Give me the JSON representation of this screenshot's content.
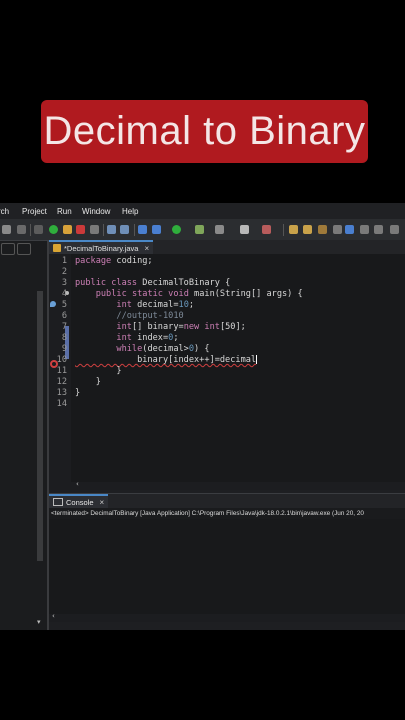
{
  "banner": {
    "title": "Decimal to Binary"
  },
  "menu": [
    "rch",
    "Project",
    "Run",
    "Window",
    "Help"
  ],
  "editor_tab": {
    "label": "*DecimalToBinary.java",
    "close": "×"
  },
  "code_lines": [
    {
      "n": "1",
      "tokens": [
        {
          "t": "package coding;",
          "c": "kw-mixed"
        }
      ]
    },
    {
      "n": "2",
      "tokens": []
    },
    {
      "n": "3",
      "tokens": []
    },
    {
      "n": "4",
      "tokens": []
    },
    {
      "n": "5",
      "tokens": []
    },
    {
      "n": "6",
      "tokens": []
    },
    {
      "n": "7",
      "tokens": []
    },
    {
      "n": "8",
      "tokens": []
    },
    {
      "n": "9",
      "tokens": []
    },
    {
      "n": "10",
      "tokens": []
    },
    {
      "n": "11",
      "tokens": []
    },
    {
      "n": "12",
      "tokens": []
    },
    {
      "n": "13",
      "tokens": []
    },
    {
      "n": "14",
      "tokens": []
    }
  ],
  "code": {
    "l1a": "package",
    "l1b": " coding;",
    "l3a": "public",
    "l3b": " ",
    "l3c": "class",
    "l3d": " DecimalToBinary {",
    "l4a": "    ",
    "l4b": "public",
    "l4c": " ",
    "l4d": "static",
    "l4e": " ",
    "l4f": "void",
    "l4g": " main(String[] args) {",
    "l5a": "        ",
    "l5b": "int",
    "l5c": " decimal=",
    "l5d": "10",
    "l5e": ";",
    "l6a": "        ",
    "l6b": "//output-1010",
    "l7a": "        ",
    "l7b": "int",
    "l7c": "[] binary=",
    "l7d": "new",
    "l7e": " ",
    "l7f": "int",
    "l7g": "[50];",
    "l8a": "        ",
    "l8b": "int",
    "l8c": " index=",
    "l8d": "0",
    "l8e": ";",
    "l9a": "        ",
    "l9b": "while",
    "l9c": "(decimal>",
    "l9d": "0",
    "l9e": ") {",
    "l10a": "            binary[index++]=decimal",
    "l11a": "        }",
    "l12a": "    }",
    "l13a": "}",
    "l14a": ""
  },
  "console_tab": {
    "label": "Console",
    "close": "×"
  },
  "console_status": "<terminated> DecimalToBinary [Java Application] C:\\Program Files\\Java\\jdk-18.0.2.1\\bin\\javaw.exe  (Jun 20, 20",
  "scroll_arrow_left": "‹",
  "colors": {
    "banner": "#b01a1f",
    "keyword": "#cc7fb5",
    "comment": "#7e8a98",
    "number": "#6897bb"
  }
}
